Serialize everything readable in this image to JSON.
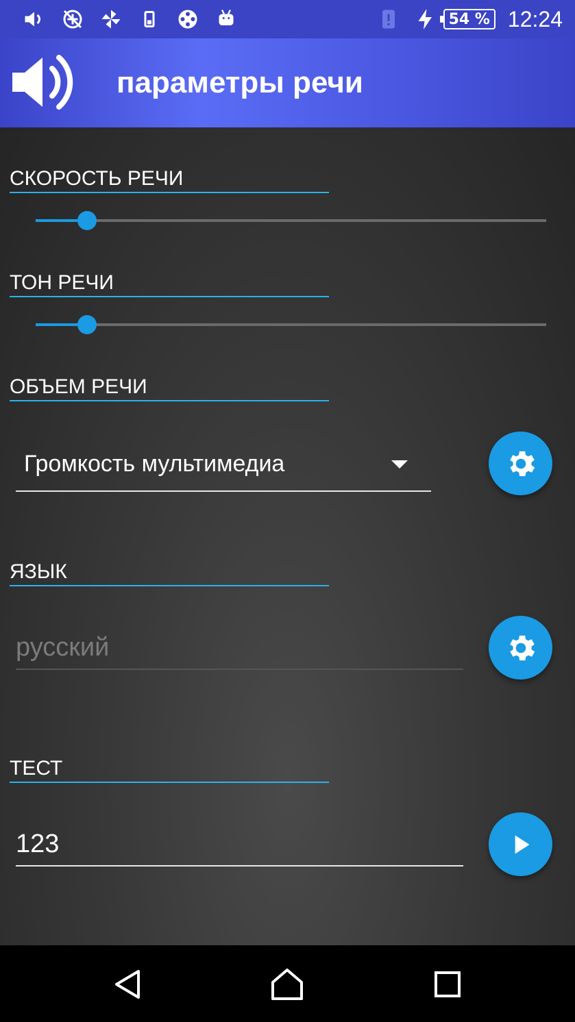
{
  "status_bar": {
    "icons": [
      "volume-icon",
      "no-sync-icon",
      "pinwheel-icon",
      "phone-signal-icon",
      "film-reel-icon",
      "android-icon"
    ],
    "notification_icon": "alert-icon",
    "charging_icon": "lightning-icon",
    "battery_percent": "54 %",
    "time": "12:24"
  },
  "app_bar": {
    "title": "параметры речи",
    "icon": "speaker-icon"
  },
  "sections": {
    "speed": {
      "title": "СКОРОСТЬ РЕЧИ",
      "slider_value": 0.1
    },
    "pitch": {
      "title": "ТОН РЕЧИ",
      "slider_value": 0.1
    },
    "volume": {
      "title": "ОБЪЕМ РЕЧИ",
      "selected": "Громкость мультимедиа"
    },
    "language": {
      "title": "ЯЗЫК",
      "placeholder": "русский",
      "value": ""
    },
    "test": {
      "title": "ТЕСТ",
      "value": "123"
    }
  },
  "colors": {
    "accent": "#1a9be3",
    "app_bar": "#4a57e0",
    "status_bar": "#3a44c4"
  },
  "nav_bar": {
    "icons": [
      "back-icon",
      "home-icon",
      "recents-icon"
    ]
  }
}
